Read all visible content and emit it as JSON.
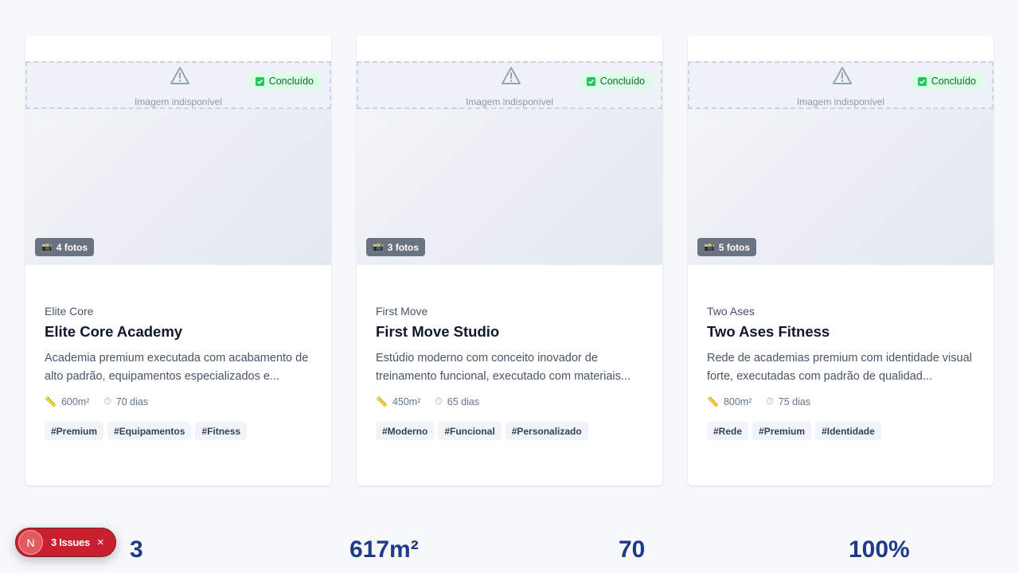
{
  "cards": [
    {
      "badge": "Concluído",
      "unavailable": "Imagem indisponível",
      "photos": "4 fotos",
      "brand": "Elite Core",
      "title": "Elite Core Academy",
      "description": "Academia premium executada com acabamento de alto padrão, equipamentos especializados e...",
      "area": "600m²",
      "duration": "70 dias",
      "tags": [
        "#Premium",
        "#Equipamentos",
        "#Fitness"
      ]
    },
    {
      "badge": "Concluído",
      "unavailable": "Imagem indisponível",
      "photos": "3 fotos",
      "brand": "First Move",
      "title": "First Move Studio",
      "description": "Estúdio moderno com conceito inovador de treinamento funcional, executado com materiais...",
      "area": "450m²",
      "duration": "65 dias",
      "tags": [
        "#Moderno",
        "#Funcional",
        "#Personalizado"
      ]
    },
    {
      "badge": "Concluído",
      "unavailable": "Imagem indisponível",
      "photos": "5 fotos",
      "brand": "Two Ases",
      "title": "Two Ases Fitness",
      "description": "Rede de academias premium com identidade visual forte, executadas com padrão de qualidad...",
      "area": "800m²",
      "duration": "75 dias",
      "tags": [
        "#Rede",
        "#Premium",
        "#Identidade"
      ]
    }
  ],
  "stats": [
    "3",
    "617m²",
    "70",
    "100%"
  ],
  "issues": {
    "logo": "N",
    "label": "3 Issues",
    "close": "×"
  },
  "icons": {
    "warning": "warning-triangle-icon",
    "camera": "📸",
    "ruler": "📏",
    "timer": "⏱"
  },
  "colors": {
    "accent": "#1e3a8a",
    "success": "#22c55e",
    "issues": "#c8202f"
  }
}
